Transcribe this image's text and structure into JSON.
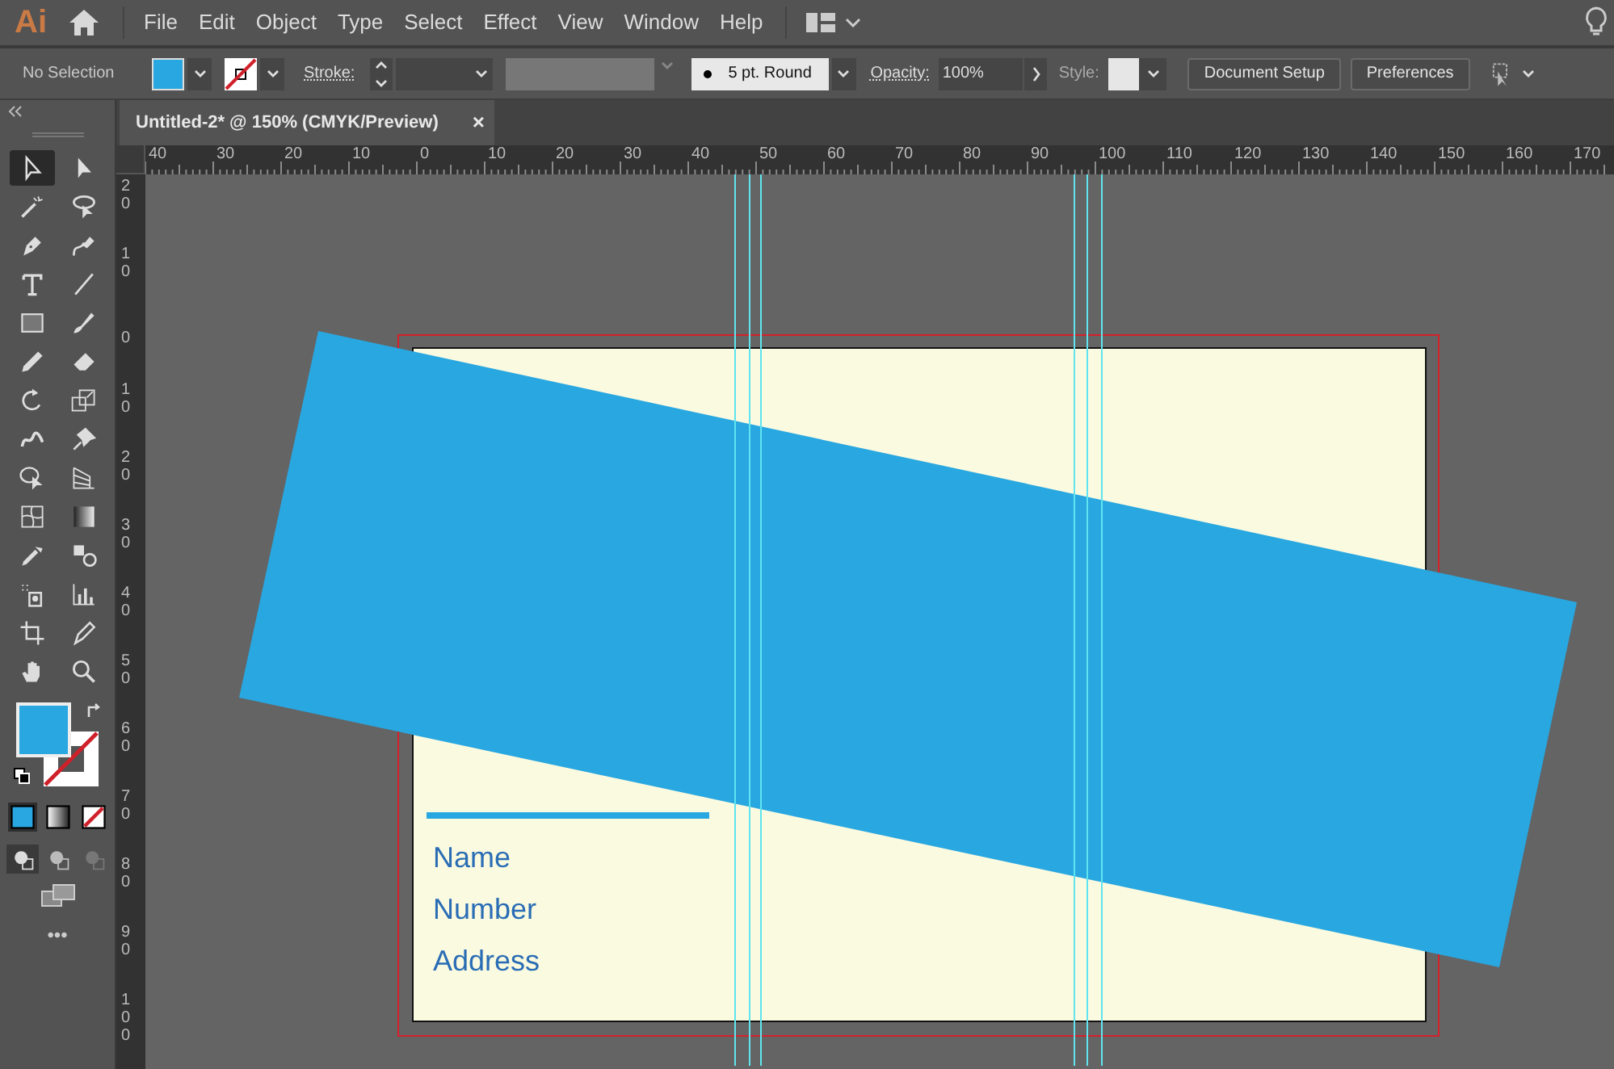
{
  "app": {
    "logo": "Ai"
  },
  "menu": [
    "File",
    "Edit",
    "Object",
    "Type",
    "Select",
    "Effect",
    "View",
    "Window",
    "Help"
  ],
  "control_bar": {
    "selection_label": "No Selection",
    "stroke_none": true,
    "stroke_label": "Stroke:",
    "brush": "5 pt. Round",
    "opacity_label": "Opacity:",
    "opacity_value": "100%",
    "style_label": "Style:",
    "buttons": [
      "Document Setup",
      "Preferences"
    ]
  },
  "document_tab": {
    "title": "Untitled-2* @ 150% (CMYK/Preview)",
    "close": "×",
    "selected": true
  },
  "rulers": {
    "horizontal": [
      "40",
      "30",
      "20",
      "10",
      "0",
      "10",
      "20",
      "30",
      "40",
      "50",
      "60",
      "70",
      "80",
      "90",
      "100",
      "110",
      "120",
      "130",
      "140",
      "150",
      "160",
      "170"
    ],
    "vertical": [
      "20",
      "10",
      "0",
      "10",
      "20",
      "30",
      "40",
      "50",
      "60",
      "70",
      "80",
      "90",
      "100"
    ]
  },
  "tools": [
    {
      "kind": "selection",
      "selected": true
    },
    {
      "kind": "direct-selection",
      "selected": false
    },
    {
      "kind": "magic-wand",
      "selected": false
    },
    {
      "kind": "lasso",
      "selected": false
    },
    {
      "kind": "pen",
      "selected": false
    },
    {
      "kind": "curvature",
      "selected": false
    },
    {
      "kind": "type",
      "selected": false
    },
    {
      "kind": "line",
      "selected": false
    },
    {
      "kind": "rectangle",
      "selected": false
    },
    {
      "kind": "paintbrush",
      "selected": false
    },
    {
      "kind": "pencil",
      "selected": false
    },
    {
      "kind": "eraser",
      "selected": false
    },
    {
      "kind": "rotate",
      "selected": false
    },
    {
      "kind": "scale",
      "selected": false
    },
    {
      "kind": "warp",
      "selected": false
    },
    {
      "kind": "pin",
      "selected": false
    },
    {
      "kind": "shape-builder",
      "selected": false
    },
    {
      "kind": "perspective",
      "selected": false
    },
    {
      "kind": "mesh",
      "selected": false
    },
    {
      "kind": "gradient",
      "selected": false
    },
    {
      "kind": "eyedropper",
      "selected": false
    },
    {
      "kind": "blend",
      "selected": false
    },
    {
      "kind": "sprayer",
      "selected": false
    },
    {
      "kind": "graph",
      "selected": false
    },
    {
      "kind": "artboard",
      "selected": false
    },
    {
      "kind": "slice",
      "selected": false
    },
    {
      "kind": "hand",
      "selected": false
    },
    {
      "kind": "zoom",
      "selected": false
    }
  ],
  "color_widget": {
    "stroke_none": true,
    "modes": [
      {
        "kind": "color",
        "selected": true
      },
      {
        "kind": "gradient",
        "selected": false
      },
      {
        "kind": "none",
        "selected": false
      }
    ],
    "draw_modes": [
      {
        "kind": "normal",
        "selected": true
      },
      {
        "kind": "behind",
        "selected": false
      },
      {
        "kind": "inside",
        "selected": false
      }
    ]
  },
  "more_tools": "•••",
  "artboard": {
    "fields": [
      "Name",
      "Number",
      "Address"
    ]
  }
}
